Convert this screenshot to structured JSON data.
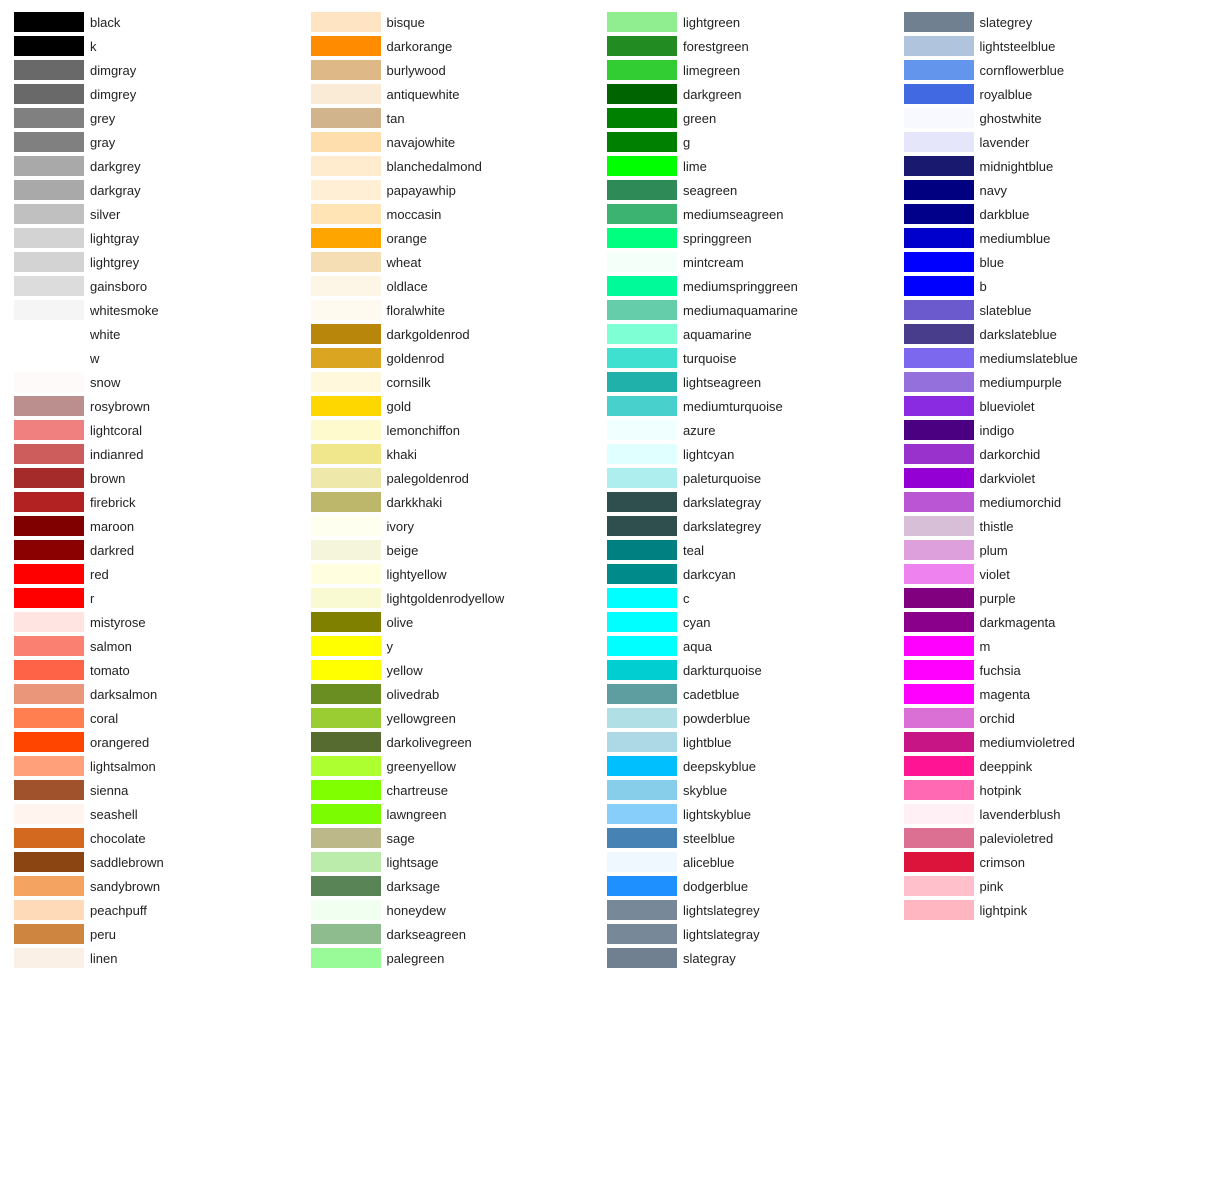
{
  "columns": [
    {
      "id": "col1",
      "items": [
        {
          "name": "black",
          "color": "#000000"
        },
        {
          "name": "k",
          "color": "#000000"
        },
        {
          "name": "dimgray",
          "color": "#696969"
        },
        {
          "name": "dimgrey",
          "color": "#696969"
        },
        {
          "name": "grey",
          "color": "#808080"
        },
        {
          "name": "gray",
          "color": "#808080"
        },
        {
          "name": "darkgrey",
          "color": "#a9a9a9"
        },
        {
          "name": "darkgray",
          "color": "#a9a9a9"
        },
        {
          "name": "silver",
          "color": "#c0c0c0"
        },
        {
          "name": "lightgray",
          "color": "#d3d3d3"
        },
        {
          "name": "lightgrey",
          "color": "#d3d3d3"
        },
        {
          "name": "gainsboro",
          "color": "#dcdcdc"
        },
        {
          "name": "whitesmoke",
          "color": "#f5f5f5"
        },
        {
          "name": "white",
          "color": "#ffffff"
        },
        {
          "name": "w",
          "color": "#ffffff"
        },
        {
          "name": "snow",
          "color": "#fffafa"
        },
        {
          "name": "rosybrown",
          "color": "#bc8f8f"
        },
        {
          "name": "lightcoral",
          "color": "#f08080"
        },
        {
          "name": "indianred",
          "color": "#cd5c5c"
        },
        {
          "name": "brown",
          "color": "#a52a2a"
        },
        {
          "name": "firebrick",
          "color": "#b22222"
        },
        {
          "name": "maroon",
          "color": "#800000"
        },
        {
          "name": "darkred",
          "color": "#8b0000"
        },
        {
          "name": "red",
          "color": "#ff0000"
        },
        {
          "name": "r",
          "color": "#ff0000"
        },
        {
          "name": "mistyrose",
          "color": "#ffe4e1"
        },
        {
          "name": "salmon",
          "color": "#fa8072"
        },
        {
          "name": "tomato",
          "color": "#ff6347"
        },
        {
          "name": "darksalmon",
          "color": "#e9967a"
        },
        {
          "name": "coral",
          "color": "#ff7f50"
        },
        {
          "name": "orangered",
          "color": "#ff4500"
        },
        {
          "name": "lightsalmon",
          "color": "#ffa07a"
        },
        {
          "name": "sienna",
          "color": "#a0522d"
        },
        {
          "name": "seashell",
          "color": "#fff5ee"
        },
        {
          "name": "chocolate",
          "color": "#d2691e"
        },
        {
          "name": "saddlebrown",
          "color": "#8b4513"
        },
        {
          "name": "sandybrown",
          "color": "#f4a460"
        },
        {
          "name": "peachpuff",
          "color": "#ffdab9"
        },
        {
          "name": "peru",
          "color": "#cd853f"
        },
        {
          "name": "linen",
          "color": "#faf0e6"
        }
      ]
    },
    {
      "id": "col2",
      "items": [
        {
          "name": "bisque",
          "color": "#ffe4c4"
        },
        {
          "name": "darkorange",
          "color": "#ff8c00"
        },
        {
          "name": "burlywood",
          "color": "#deb887"
        },
        {
          "name": "antiquewhite",
          "color": "#faebd7"
        },
        {
          "name": "tan",
          "color": "#d2b48c"
        },
        {
          "name": "navajowhite",
          "color": "#ffdead"
        },
        {
          "name": "blanchedalmond",
          "color": "#ffebcd"
        },
        {
          "name": "papayawhip",
          "color": "#ffefd5"
        },
        {
          "name": "moccasin",
          "color": "#ffe4b5"
        },
        {
          "name": "orange",
          "color": "#ffa500"
        },
        {
          "name": "wheat",
          "color": "#f5deb3"
        },
        {
          "name": "oldlace",
          "color": "#fdf5e6"
        },
        {
          "name": "floralwhite",
          "color": "#fffaf0"
        },
        {
          "name": "darkgoldenrod",
          "color": "#b8860b"
        },
        {
          "name": "goldenrod",
          "color": "#daa520"
        },
        {
          "name": "cornsilk",
          "color": "#fff8dc"
        },
        {
          "name": "gold",
          "color": "#ffd700"
        },
        {
          "name": "lemonchiffon",
          "color": "#fffacd"
        },
        {
          "name": "khaki",
          "color": "#f0e68c"
        },
        {
          "name": "palegoldenrod",
          "color": "#eee8aa"
        },
        {
          "name": "darkkhaki",
          "color": "#bdb76b"
        },
        {
          "name": "ivory",
          "color": "#fffff0"
        },
        {
          "name": "beige",
          "color": "#f5f5dc"
        },
        {
          "name": "lightyellow",
          "color": "#ffffe0"
        },
        {
          "name": "lightgoldenrodyellow",
          "color": "#fafad2"
        },
        {
          "name": "olive",
          "color": "#808000"
        },
        {
          "name": "y",
          "color": "#ffff00"
        },
        {
          "name": "yellow",
          "color": "#ffff00"
        },
        {
          "name": "olivedrab",
          "color": "#6b8e23"
        },
        {
          "name": "yellowgreen",
          "color": "#9acd32"
        },
        {
          "name": "darkolivegreen",
          "color": "#556b2f"
        },
        {
          "name": "greenyellow",
          "color": "#adff2f"
        },
        {
          "name": "chartreuse",
          "color": "#7fff00"
        },
        {
          "name": "lawngreen",
          "color": "#7cfc00"
        },
        {
          "name": "sage",
          "color": "#bcb88a"
        },
        {
          "name": "lightsage",
          "color": "#bcecac"
        },
        {
          "name": "darksage",
          "color": "#598556"
        },
        {
          "name": "honeydew",
          "color": "#f0fff0"
        },
        {
          "name": "darkseagreen",
          "color": "#8fbc8f"
        },
        {
          "name": "palegreen",
          "color": "#98fb98"
        }
      ]
    },
    {
      "id": "col3",
      "items": [
        {
          "name": "lightgreen",
          "color": "#90ee90"
        },
        {
          "name": "forestgreen",
          "color": "#228b22"
        },
        {
          "name": "limegreen",
          "color": "#32cd32"
        },
        {
          "name": "darkgreen",
          "color": "#006400"
        },
        {
          "name": "green",
          "color": "#008000"
        },
        {
          "name": "g",
          "color": "#008000"
        },
        {
          "name": "lime",
          "color": "#00ff00"
        },
        {
          "name": "seagreen",
          "color": "#2e8b57"
        },
        {
          "name": "mediumseagreen",
          "color": "#3cb371"
        },
        {
          "name": "springgreen",
          "color": "#00ff7f"
        },
        {
          "name": "mintcream",
          "color": "#f5fffa"
        },
        {
          "name": "mediumspringgreen",
          "color": "#00fa9a"
        },
        {
          "name": "mediumaquamarine",
          "color": "#66cdaa"
        },
        {
          "name": "aquamarine",
          "color": "#7fffd4"
        },
        {
          "name": "turquoise",
          "color": "#40e0d0"
        },
        {
          "name": "lightseagreen",
          "color": "#20b2aa"
        },
        {
          "name": "mediumturquoise",
          "color": "#48d1cc"
        },
        {
          "name": "azure",
          "color": "#f0ffff"
        },
        {
          "name": "lightcyan",
          "color": "#e0ffff"
        },
        {
          "name": "paleturquoise",
          "color": "#afeeee"
        },
        {
          "name": "darkslategray",
          "color": "#2f4f4f"
        },
        {
          "name": "darkslategrey",
          "color": "#2f4f4f"
        },
        {
          "name": "teal",
          "color": "#008080"
        },
        {
          "name": "darkcyan",
          "color": "#008b8b"
        },
        {
          "name": "c",
          "color": "#00ffff"
        },
        {
          "name": "cyan",
          "color": "#00ffff"
        },
        {
          "name": "aqua",
          "color": "#00ffff"
        },
        {
          "name": "darkturquoise",
          "color": "#00ced1"
        },
        {
          "name": "cadetblue",
          "color": "#5f9ea0"
        },
        {
          "name": "powderblue",
          "color": "#b0e0e6"
        },
        {
          "name": "lightblue",
          "color": "#add8e6"
        },
        {
          "name": "deepskyblue",
          "color": "#00bfff"
        },
        {
          "name": "skyblue",
          "color": "#87ceeb"
        },
        {
          "name": "lightskyblue",
          "color": "#87cefa"
        },
        {
          "name": "steelblue",
          "color": "#4682b4"
        },
        {
          "name": "aliceblue",
          "color": "#f0f8ff"
        },
        {
          "name": "dodgerblue",
          "color": "#1e90ff"
        },
        {
          "name": "lightslategrey",
          "color": "#778899"
        },
        {
          "name": "lightslategray",
          "color": "#778899"
        },
        {
          "name": "slategray",
          "color": "#708090"
        }
      ]
    },
    {
      "id": "col4",
      "items": [
        {
          "name": "slategrey",
          "color": "#708090"
        },
        {
          "name": "lightsteelblue",
          "color": "#b0c4de"
        },
        {
          "name": "cornflowerblue",
          "color": "#6495ed"
        },
        {
          "name": "royalblue",
          "color": "#4169e1"
        },
        {
          "name": "ghostwhite",
          "color": "#f8f8ff"
        },
        {
          "name": "lavender",
          "color": "#e6e6fa"
        },
        {
          "name": "midnightblue",
          "color": "#191970"
        },
        {
          "name": "navy",
          "color": "#000080"
        },
        {
          "name": "darkblue",
          "color": "#00008b"
        },
        {
          "name": "mediumblue",
          "color": "#0000cd"
        },
        {
          "name": "blue",
          "color": "#0000ff"
        },
        {
          "name": "b",
          "color": "#0000ff"
        },
        {
          "name": "slateblue",
          "color": "#6a5acd"
        },
        {
          "name": "darkslateblue",
          "color": "#483d8b"
        },
        {
          "name": "mediumslateblue",
          "color": "#7b68ee"
        },
        {
          "name": "mediumpurple",
          "color": "#9370db"
        },
        {
          "name": "blueviolet",
          "color": "#8a2be2"
        },
        {
          "name": "indigo",
          "color": "#4b0082"
        },
        {
          "name": "darkorchid",
          "color": "#9932cc"
        },
        {
          "name": "darkviolet",
          "color": "#9400d3"
        },
        {
          "name": "mediumorchid",
          "color": "#ba55d3"
        },
        {
          "name": "thistle",
          "color": "#d8bfd8"
        },
        {
          "name": "plum",
          "color": "#dda0dd"
        },
        {
          "name": "violet",
          "color": "#ee82ee"
        },
        {
          "name": "purple",
          "color": "#800080"
        },
        {
          "name": "darkmagenta",
          "color": "#8b008b"
        },
        {
          "name": "m",
          "color": "#ff00ff"
        },
        {
          "name": "fuchsia",
          "color": "#ff00ff"
        },
        {
          "name": "magenta",
          "color": "#ff00ff"
        },
        {
          "name": "orchid",
          "color": "#da70d6"
        },
        {
          "name": "mediumvioletred",
          "color": "#c71585"
        },
        {
          "name": "deeppink",
          "color": "#ff1493"
        },
        {
          "name": "hotpink",
          "color": "#ff69b4"
        },
        {
          "name": "lavenderblush",
          "color": "#fff0f5"
        },
        {
          "name": "palevioletred",
          "color": "#db7093"
        },
        {
          "name": "crimson",
          "color": "#dc143c"
        },
        {
          "name": "pink",
          "color": "#ffc0cb"
        },
        {
          "name": "lightpink",
          "color": "#ffb6c1"
        }
      ]
    }
  ]
}
